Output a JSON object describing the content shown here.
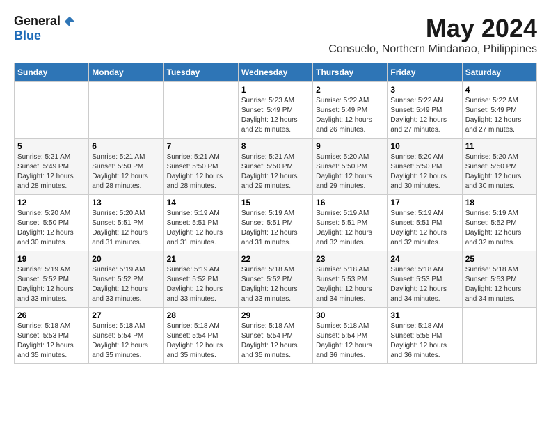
{
  "header": {
    "logo_general": "General",
    "logo_blue": "Blue",
    "month_title": "May 2024",
    "location": "Consuelo, Northern Mindanao, Philippines"
  },
  "days_of_week": [
    "Sunday",
    "Monday",
    "Tuesday",
    "Wednesday",
    "Thursday",
    "Friday",
    "Saturday"
  ],
  "weeks": [
    [
      {
        "day": "",
        "info": ""
      },
      {
        "day": "",
        "info": ""
      },
      {
        "day": "",
        "info": ""
      },
      {
        "day": "1",
        "info": "Sunrise: 5:23 AM\nSunset: 5:49 PM\nDaylight: 12 hours and 26 minutes."
      },
      {
        "day": "2",
        "info": "Sunrise: 5:22 AM\nSunset: 5:49 PM\nDaylight: 12 hours and 26 minutes."
      },
      {
        "day": "3",
        "info": "Sunrise: 5:22 AM\nSunset: 5:49 PM\nDaylight: 12 hours and 27 minutes."
      },
      {
        "day": "4",
        "info": "Sunrise: 5:22 AM\nSunset: 5:49 PM\nDaylight: 12 hours and 27 minutes."
      }
    ],
    [
      {
        "day": "5",
        "info": "Sunrise: 5:21 AM\nSunset: 5:49 PM\nDaylight: 12 hours and 28 minutes."
      },
      {
        "day": "6",
        "info": "Sunrise: 5:21 AM\nSunset: 5:50 PM\nDaylight: 12 hours and 28 minutes."
      },
      {
        "day": "7",
        "info": "Sunrise: 5:21 AM\nSunset: 5:50 PM\nDaylight: 12 hours and 28 minutes."
      },
      {
        "day": "8",
        "info": "Sunrise: 5:21 AM\nSunset: 5:50 PM\nDaylight: 12 hours and 29 minutes."
      },
      {
        "day": "9",
        "info": "Sunrise: 5:20 AM\nSunset: 5:50 PM\nDaylight: 12 hours and 29 minutes."
      },
      {
        "day": "10",
        "info": "Sunrise: 5:20 AM\nSunset: 5:50 PM\nDaylight: 12 hours and 30 minutes."
      },
      {
        "day": "11",
        "info": "Sunrise: 5:20 AM\nSunset: 5:50 PM\nDaylight: 12 hours and 30 minutes."
      }
    ],
    [
      {
        "day": "12",
        "info": "Sunrise: 5:20 AM\nSunset: 5:50 PM\nDaylight: 12 hours and 30 minutes."
      },
      {
        "day": "13",
        "info": "Sunrise: 5:20 AM\nSunset: 5:51 PM\nDaylight: 12 hours and 31 minutes."
      },
      {
        "day": "14",
        "info": "Sunrise: 5:19 AM\nSunset: 5:51 PM\nDaylight: 12 hours and 31 minutes."
      },
      {
        "day": "15",
        "info": "Sunrise: 5:19 AM\nSunset: 5:51 PM\nDaylight: 12 hours and 31 minutes."
      },
      {
        "day": "16",
        "info": "Sunrise: 5:19 AM\nSunset: 5:51 PM\nDaylight: 12 hours and 32 minutes."
      },
      {
        "day": "17",
        "info": "Sunrise: 5:19 AM\nSunset: 5:51 PM\nDaylight: 12 hours and 32 minutes."
      },
      {
        "day": "18",
        "info": "Sunrise: 5:19 AM\nSunset: 5:52 PM\nDaylight: 12 hours and 32 minutes."
      }
    ],
    [
      {
        "day": "19",
        "info": "Sunrise: 5:19 AM\nSunset: 5:52 PM\nDaylight: 12 hours and 33 minutes."
      },
      {
        "day": "20",
        "info": "Sunrise: 5:19 AM\nSunset: 5:52 PM\nDaylight: 12 hours and 33 minutes."
      },
      {
        "day": "21",
        "info": "Sunrise: 5:19 AM\nSunset: 5:52 PM\nDaylight: 12 hours and 33 minutes."
      },
      {
        "day": "22",
        "info": "Sunrise: 5:18 AM\nSunset: 5:52 PM\nDaylight: 12 hours and 33 minutes."
      },
      {
        "day": "23",
        "info": "Sunrise: 5:18 AM\nSunset: 5:53 PM\nDaylight: 12 hours and 34 minutes."
      },
      {
        "day": "24",
        "info": "Sunrise: 5:18 AM\nSunset: 5:53 PM\nDaylight: 12 hours and 34 minutes."
      },
      {
        "day": "25",
        "info": "Sunrise: 5:18 AM\nSunset: 5:53 PM\nDaylight: 12 hours and 34 minutes."
      }
    ],
    [
      {
        "day": "26",
        "info": "Sunrise: 5:18 AM\nSunset: 5:53 PM\nDaylight: 12 hours and 35 minutes."
      },
      {
        "day": "27",
        "info": "Sunrise: 5:18 AM\nSunset: 5:54 PM\nDaylight: 12 hours and 35 minutes."
      },
      {
        "day": "28",
        "info": "Sunrise: 5:18 AM\nSunset: 5:54 PM\nDaylight: 12 hours and 35 minutes."
      },
      {
        "day": "29",
        "info": "Sunrise: 5:18 AM\nSunset: 5:54 PM\nDaylight: 12 hours and 35 minutes."
      },
      {
        "day": "30",
        "info": "Sunrise: 5:18 AM\nSunset: 5:54 PM\nDaylight: 12 hours and 36 minutes."
      },
      {
        "day": "31",
        "info": "Sunrise: 5:18 AM\nSunset: 5:55 PM\nDaylight: 12 hours and 36 minutes."
      },
      {
        "day": "",
        "info": ""
      }
    ]
  ]
}
